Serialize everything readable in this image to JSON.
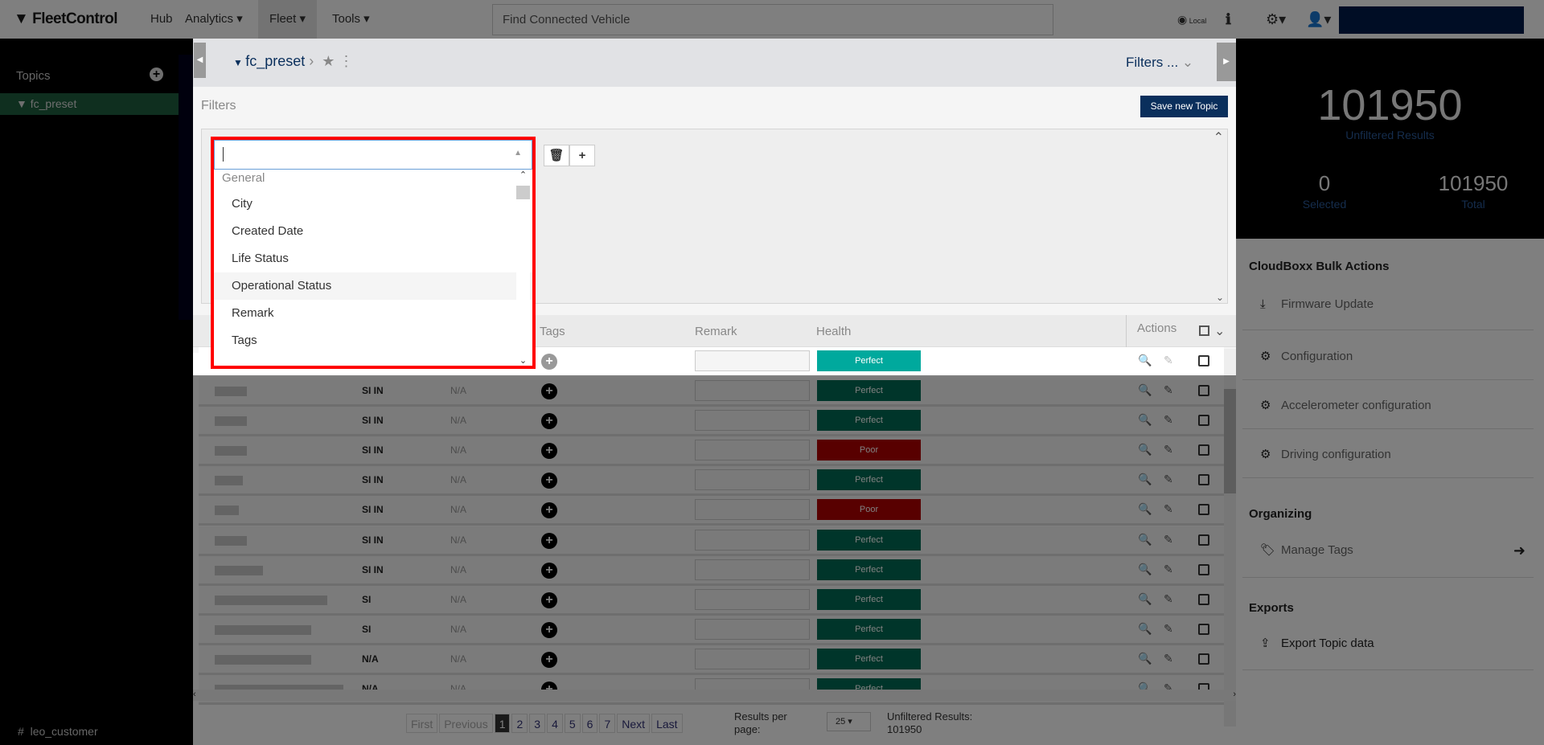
{
  "nav": {
    "logo": "FleetControl",
    "items": [
      {
        "label": "Hub"
      },
      {
        "label": "Analytics ▾"
      },
      {
        "label": "Fleet ▾"
      },
      {
        "label": "Tools ▾"
      }
    ],
    "search_placeholder": "Find Connected Vehicle",
    "locale": "Local"
  },
  "sidebar": {
    "title": "Topics",
    "active_topic": "fc_preset",
    "bottom_topic": "leo_customer"
  },
  "header": {
    "title": "fc_preset",
    "filters_label": "Filters ..."
  },
  "filters": {
    "label": "Filters",
    "save_button": "Save new Topic",
    "dropdown": {
      "group": "General",
      "options": [
        "City",
        "Created Date",
        "Life Status",
        "Operational Status",
        "Remark",
        "Tags"
      ],
      "hovered": "Operational Status"
    }
  },
  "table": {
    "headers": {
      "tags": "Tags",
      "remark": "Remark",
      "health": "Health",
      "actions": "Actions"
    },
    "rows": [
      {
        "col2": "SI IN",
        "col3": "N/A",
        "health": "Perfect"
      },
      {
        "col2": "SI IN",
        "col3": "N/A",
        "health": "Perfect"
      },
      {
        "col2": "SI IN",
        "col3": "N/A",
        "health": "Poor"
      },
      {
        "col2": "SI IN",
        "col3": "N/A",
        "health": "Perfect"
      },
      {
        "col2": "SI IN",
        "col3": "N/A",
        "health": "Poor"
      },
      {
        "col2": "SI IN",
        "col3": "N/A",
        "health": "Perfect"
      },
      {
        "col2": "SI IN",
        "col3": "N/A",
        "health": "Perfect"
      },
      {
        "col2": "SI",
        "col3": "N/A",
        "health": "Perfect"
      },
      {
        "col2": "SI",
        "col3": "N/A",
        "health": "Perfect"
      },
      {
        "col2": "N/A",
        "col3": "N/A",
        "health": "Perfect"
      },
      {
        "col2": "N/A",
        "col3": "N/A",
        "health": "Perfect"
      }
    ],
    "first_row_health": "Perfect"
  },
  "pagination": {
    "first": "First",
    "previous": "Previous",
    "pages": [
      "1",
      "2",
      "3",
      "4",
      "5",
      "6",
      "7"
    ],
    "current": "1",
    "next": "Next",
    "last": "Last",
    "per_page_label": "Results per page:",
    "per_page": "25",
    "unfiltered_label": "Unfiltered Results:",
    "unfiltered_value": "101950"
  },
  "stats": {
    "unfiltered": "101950",
    "unfiltered_label": "Unfiltered Results",
    "selected": "0",
    "selected_label": "Selected",
    "total": "101950",
    "total_label": "Total"
  },
  "actions": {
    "bulk_title": "CloudBoxx Bulk Actions",
    "bulk": [
      {
        "label": "Firmware Update",
        "icon": "download-icon"
      },
      {
        "label": "Configuration",
        "icon": "gear-icon"
      },
      {
        "label": "Accelerometer configuration",
        "icon": "gear-icon"
      },
      {
        "label": "Driving configuration",
        "icon": "gear-icon"
      }
    ],
    "organizing_title": "Organizing",
    "manage_tags": "Manage Tags",
    "exports_title": "Exports",
    "export_topic": "Export Topic data"
  },
  "colors": {
    "perfect": "#00a99d",
    "poor": "#b00000",
    "brand": "#0a2f5c",
    "topic_active": "#1e5f3f"
  }
}
